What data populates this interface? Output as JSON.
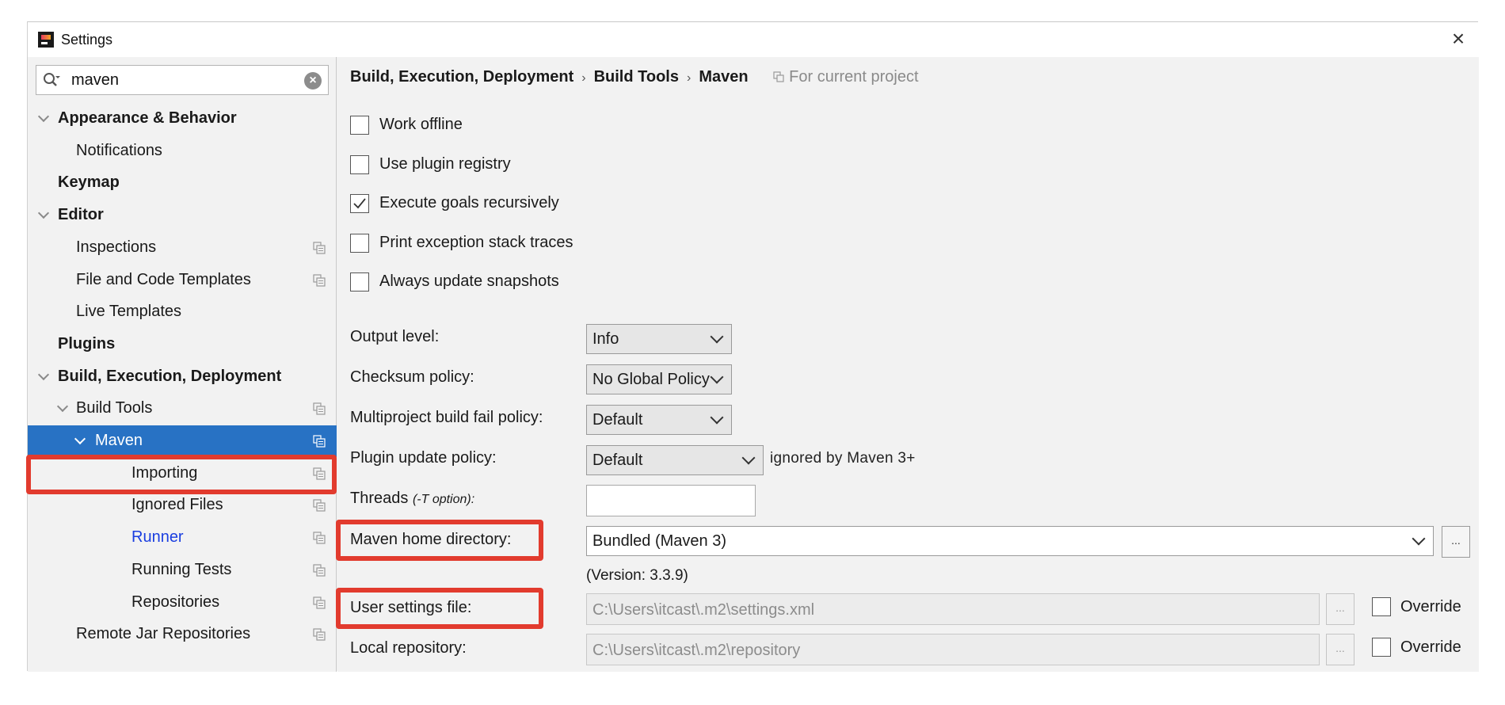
{
  "window": {
    "title": "Settings"
  },
  "search": {
    "value": "maven"
  },
  "tree": [
    {
      "label": "Appearance & Behavior",
      "bold": true,
      "expanded": true,
      "level": 0
    },
    {
      "label": "Notifications",
      "level": 1
    },
    {
      "label": "Keymap",
      "bold": true,
      "level": 0
    },
    {
      "label": "Editor",
      "bold": true,
      "expanded": true,
      "level": 0
    },
    {
      "label": "Inspections",
      "level": 1,
      "project_icon": true
    },
    {
      "label": "File and Code Templates",
      "level": 1,
      "project_icon": true
    },
    {
      "label": "Live Templates",
      "level": 1
    },
    {
      "label": "Plugins",
      "bold": true,
      "level": 0
    },
    {
      "label": "Build, Execution, Deployment",
      "bold": true,
      "expanded": true,
      "level": 0
    },
    {
      "label": "Build Tools",
      "level": 1,
      "expanded": true,
      "project_icon": true
    },
    {
      "label": "Maven",
      "level": 2,
      "expanded": true,
      "selected": true,
      "project_icon": true
    },
    {
      "label": "Importing",
      "level": 3,
      "project_icon": true
    },
    {
      "label": "Ignored Files",
      "level": 3,
      "project_icon": true
    },
    {
      "label": "Runner",
      "level": 3,
      "link": true,
      "project_icon": true
    },
    {
      "label": "Running Tests",
      "level": 3,
      "project_icon": true
    },
    {
      "label": "Repositories",
      "level": 3,
      "project_icon": true
    },
    {
      "label": "Remote Jar Repositories",
      "level": 1,
      "project_icon": true
    }
  ],
  "breadcrumb": {
    "items": [
      "Build, Execution, Deployment",
      "Build Tools",
      "Maven"
    ],
    "separator": "›",
    "scope": "For current project"
  },
  "checkboxes": [
    {
      "label": "Work offline",
      "checked": false
    },
    {
      "label": "Use plugin registry",
      "checked": false
    },
    {
      "label": "Execute goals recursively",
      "checked": true
    },
    {
      "label": "Print exception stack traces",
      "checked": false
    },
    {
      "label": "Always update snapshots",
      "checked": false
    }
  ],
  "form": {
    "output_level": {
      "label": "Output level:",
      "value": "Info"
    },
    "checksum_policy": {
      "label": "Checksum policy:",
      "value": "No Global Policy"
    },
    "multiproject_fail": {
      "label": "Multiproject build fail policy:",
      "value": "Default"
    },
    "plugin_update": {
      "label": "Plugin update policy:",
      "value": "Default",
      "hint": "ignored by Maven 3+"
    },
    "threads": {
      "label": "Threads",
      "label_suffix": "(-T option):",
      "value": ""
    },
    "maven_home": {
      "label": "Maven home directory:",
      "value": "Bundled (Maven 3)",
      "version": "(Version: 3.3.9)",
      "browse": "..."
    },
    "user_settings": {
      "label": "User settings file:",
      "value": "C:\\Users\\itcast\\.m2\\settings.xml",
      "browse": "...",
      "override": "Override"
    },
    "local_repo": {
      "label": "Local repository:",
      "value": "C:\\Users\\itcast\\.m2\\repository",
      "browse": "...",
      "override": "Override"
    }
  },
  "colors": {
    "selection": "#2872c4",
    "highlight": "#e23b2e",
    "link": "#1a3ee0"
  }
}
